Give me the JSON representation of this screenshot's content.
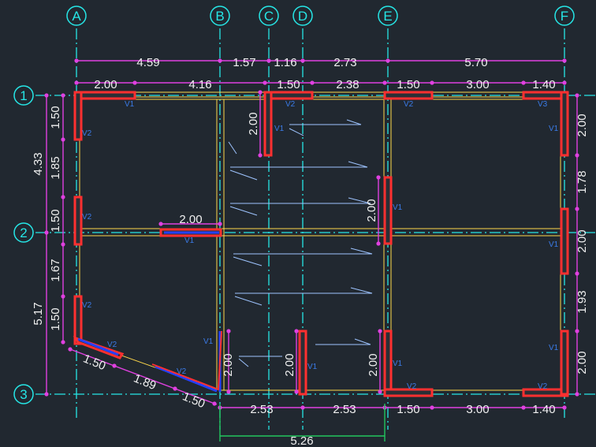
{
  "colors": {
    "background": "#212830",
    "grid": "#26e6e6",
    "dimension": "#e040e0",
    "wall": "#ff3030",
    "wall_blue": "#2540ff",
    "beam": "#ffd84a",
    "text": "#f0f0f0",
    "wall_tag": "#3b7be8",
    "stair": "#9ec4ff",
    "span_dim": "#22c55e"
  },
  "axes": {
    "columns": [
      "A",
      "B",
      "C",
      "D",
      "E",
      "F"
    ],
    "rows": [
      "1",
      "2",
      "3"
    ]
  },
  "dims": {
    "top_outer": [
      "4.59",
      "1.57",
      "1.16",
      "2.73",
      "5.70"
    ],
    "top_inner": [
      "2.00",
      "4.16",
      "1.50",
      "2.38",
      "1.50",
      "3.00",
      "1.40"
    ],
    "left_outer": [
      "4.33",
      "5.17"
    ],
    "left_inner": [
      "1.50",
      "1.85",
      "1.50",
      "1.67",
      "1.50"
    ],
    "right": [
      "2.00",
      "1.78",
      "2.00",
      "1.93",
      "2.00"
    ],
    "bottom_inner": [
      "2.53",
      "2.53",
      "1.50",
      "3.00",
      "1.40"
    ],
    "bottom_outer": "5.26",
    "slant": [
      "1.50",
      "1.89",
      "1.50"
    ],
    "inner_walls": [
      "2.00",
      "2.00",
      "2.00",
      "2.00",
      "2.00",
      "2.00"
    ]
  },
  "wall_tags": [
    "V1",
    "V2",
    "V2",
    "V3",
    "V2",
    "V1",
    "V2",
    "V1",
    "V1",
    "V1",
    "V2",
    "V1",
    "V2",
    "V2",
    "V1",
    "V1",
    "V1",
    "V2",
    "V2",
    "V1",
    "V1"
  ]
}
